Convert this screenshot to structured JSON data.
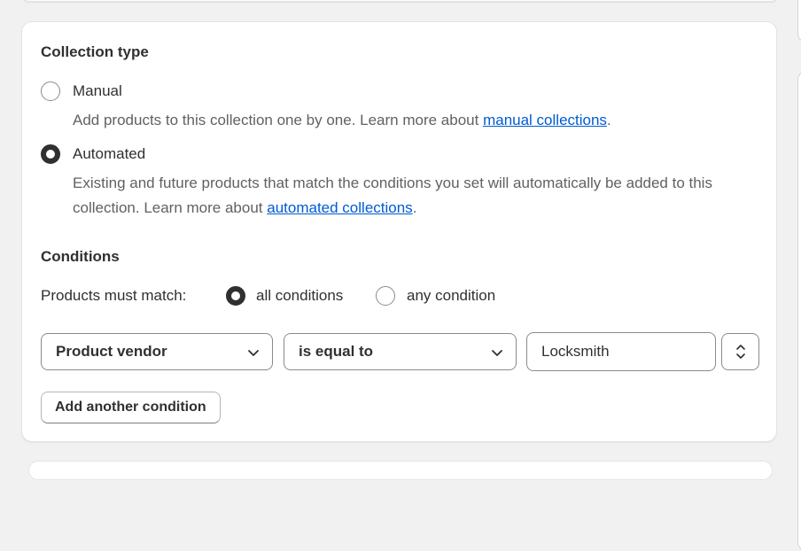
{
  "collection_type": {
    "heading": "Collection type",
    "manual": {
      "label": "Manual",
      "checked": false,
      "help_prefix": "Add products to this collection one by one. Learn more about ",
      "help_link": "manual collections",
      "help_suffix": "."
    },
    "automated": {
      "label": "Automated",
      "checked": true,
      "help_prefix": "Existing and future products that match the conditions you set will automatically be added to this collection. Learn more about ",
      "help_link": "automated collections",
      "help_suffix": "."
    }
  },
  "conditions": {
    "heading": "Conditions",
    "match_label": "Products must match:",
    "all_label": "all conditions",
    "any_label": "any condition",
    "selected": "all",
    "rule": {
      "field": "Product vendor",
      "operator": "is equal to",
      "value": "Locksmith"
    },
    "add_button": "Add another condition"
  },
  "colors": {
    "link": "#005bd3",
    "text": "#303030",
    "subdued": "#616161",
    "background": "#f1f1f1"
  },
  "icons": [
    "radio-unchecked-icon",
    "radio-checked-icon",
    "chevron-down-icon",
    "select-arrows-icon"
  ]
}
